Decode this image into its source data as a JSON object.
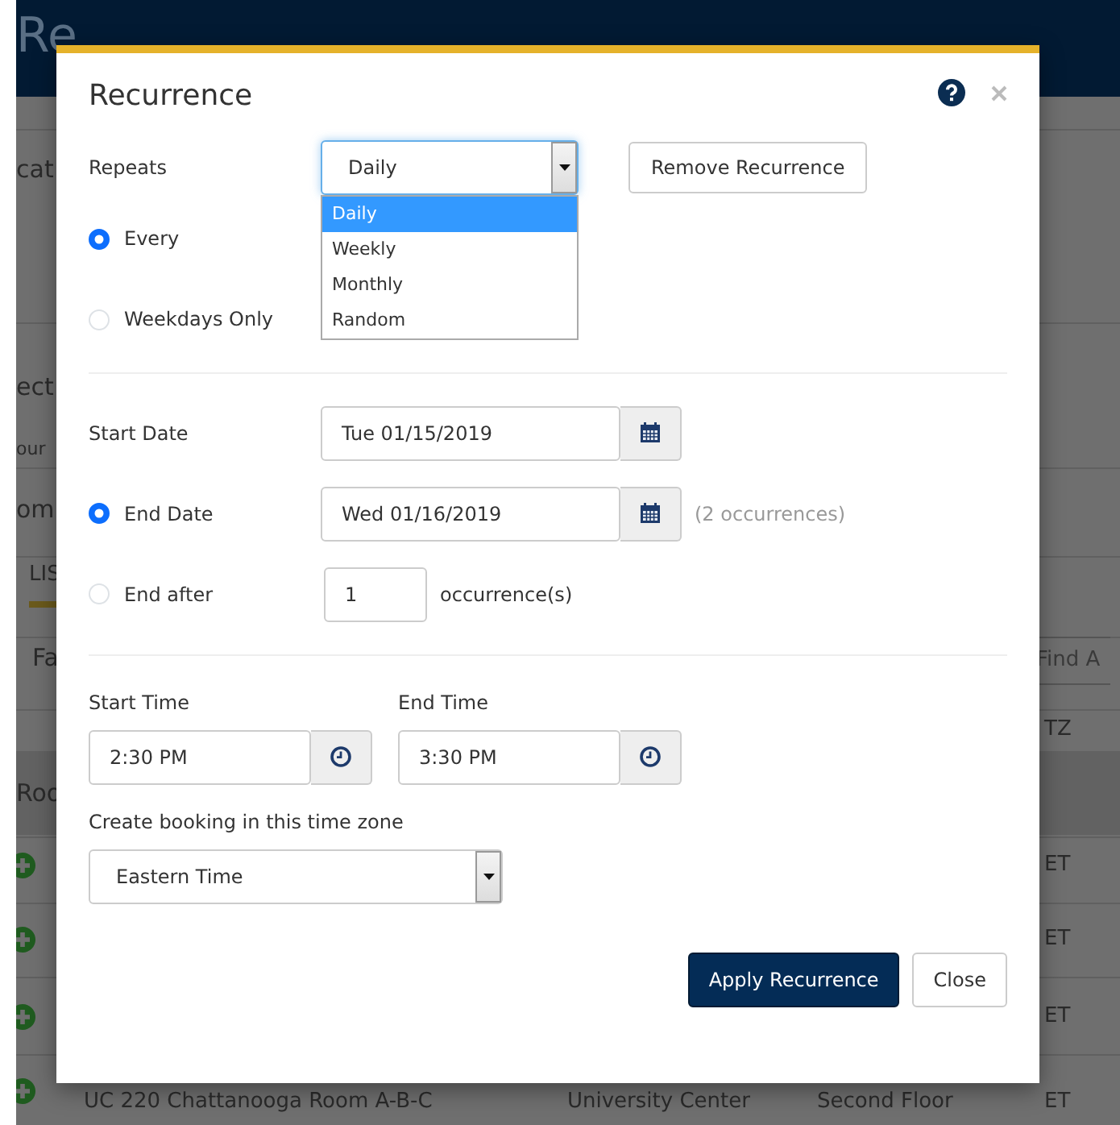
{
  "page_behind": {
    "title": "Re",
    "left": [
      {
        "kind": "text",
        "text": "cat"
      },
      {
        "kind": "text",
        "text": "ect"
      },
      {
        "kind": "text",
        "text": "our"
      },
      {
        "kind": "text",
        "text": "om"
      },
      {
        "kind": "tab",
        "text": "LIS"
      },
      {
        "kind": "text",
        "text": "Fa"
      },
      {
        "kind": "text",
        "text": "Roo"
      },
      {
        "kind": "add"
      },
      {
        "kind": "add"
      },
      {
        "kind": "add"
      },
      {
        "kind": "add"
      }
    ],
    "right": [
      {
        "kind": "field",
        "text": "Find A"
      },
      {
        "kind": "text",
        "text": "TZ"
      },
      {
        "kind": "text",
        "text": "ET"
      },
      {
        "kind": "text",
        "text": "ET"
      },
      {
        "kind": "text",
        "text": "ET"
      }
    ],
    "last_row": [
      "UC 220 Chattanooga Room A-B-C",
      "University Center",
      "Second Floor",
      "ET"
    ]
  },
  "dialog": {
    "title": "Recurrence",
    "repeats": {
      "label": "Repeats",
      "value": "Daily",
      "options": [
        {
          "label": "Daily",
          "selected": true
        },
        {
          "label": "Weekly",
          "selected": false
        },
        {
          "label": "Monthly",
          "selected": false
        },
        {
          "label": "Random",
          "selected": false
        }
      ]
    },
    "remove_button": "Remove Recurrence",
    "frequency": [
      {
        "label": "Every",
        "selected": true
      },
      {
        "label": "Weekdays Only",
        "selected": false
      }
    ],
    "start_date": {
      "label": "Start Date",
      "value": "Tue 01/15/2019"
    },
    "end": [
      {
        "kind": "date",
        "label": "End Date",
        "selected": true,
        "value": "Wed 01/16/2019",
        "note": "(2 occurrences)"
      },
      {
        "kind": "count",
        "label": "End after",
        "selected": false,
        "value": "1",
        "note": "occurrence(s)"
      }
    ],
    "start_time": {
      "label": "Start Time",
      "value": "2:30 PM"
    },
    "end_time": {
      "label": "End Time",
      "value": "3:30 PM"
    },
    "time_zone": {
      "label": "Create booking in this time zone",
      "value": "Eastern Time"
    },
    "buttons": [
      {
        "kind": "primary",
        "label": "Apply Recurrence"
      },
      {
        "kind": "secondary",
        "label": "Close"
      }
    ]
  }
}
